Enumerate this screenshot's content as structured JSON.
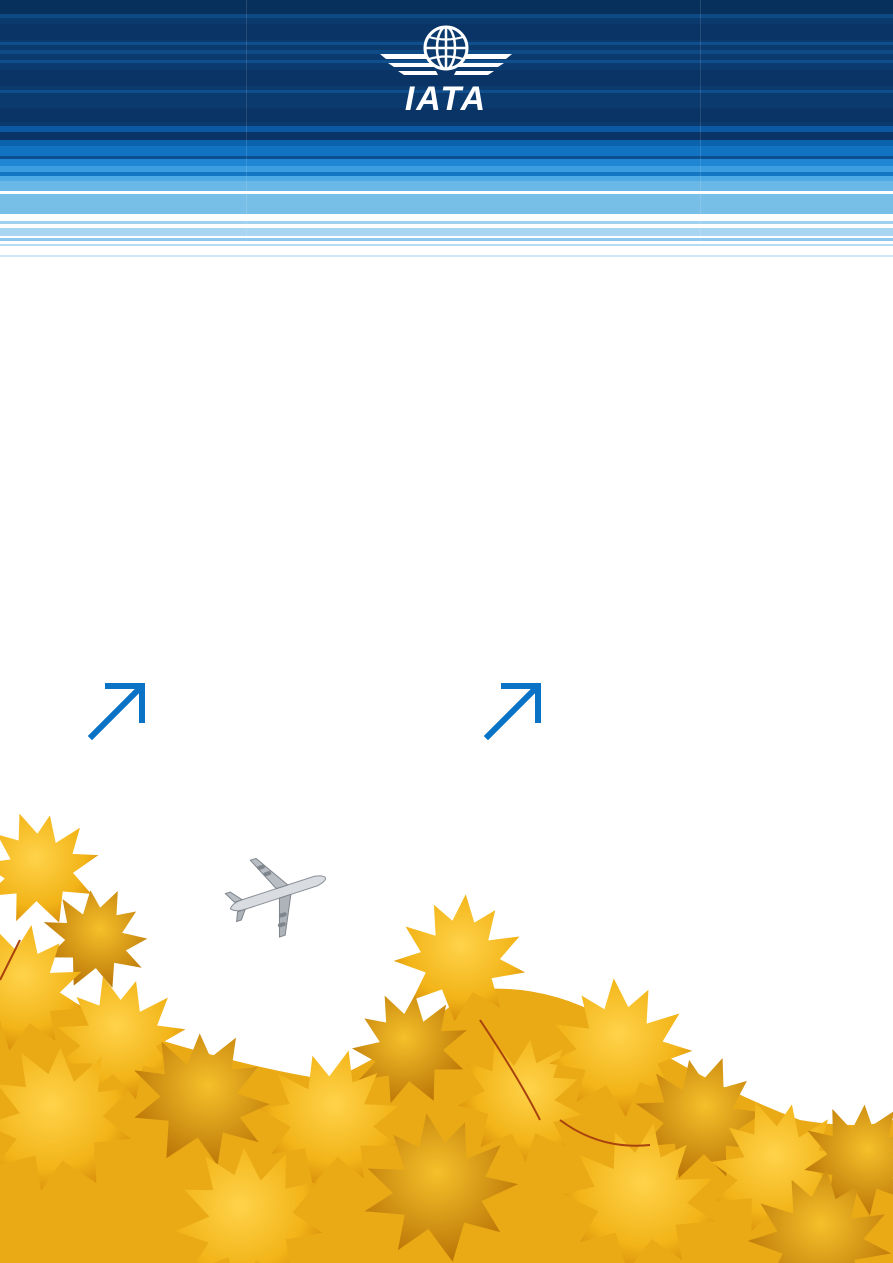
{
  "brand": {
    "logo_text": "IATA",
    "logo_icon": "globe-wings-icon",
    "colors": {
      "navy": "#0a3466",
      "blue": "#0b62ad",
      "mid_blue": "#1e86d2",
      "light_blue": "#78bfe8",
      "pale_blue": "#b6dcf3",
      "arrow_blue": "#0a73c6",
      "leaf_gold": "#f2b418",
      "leaf_amber": "#d98f0c"
    }
  },
  "decorations": {
    "arrow_icon": "diagonal-arrow-icon",
    "airplane_icon": "airplane-icon",
    "foliage": "autumn-maple-leaves"
  }
}
